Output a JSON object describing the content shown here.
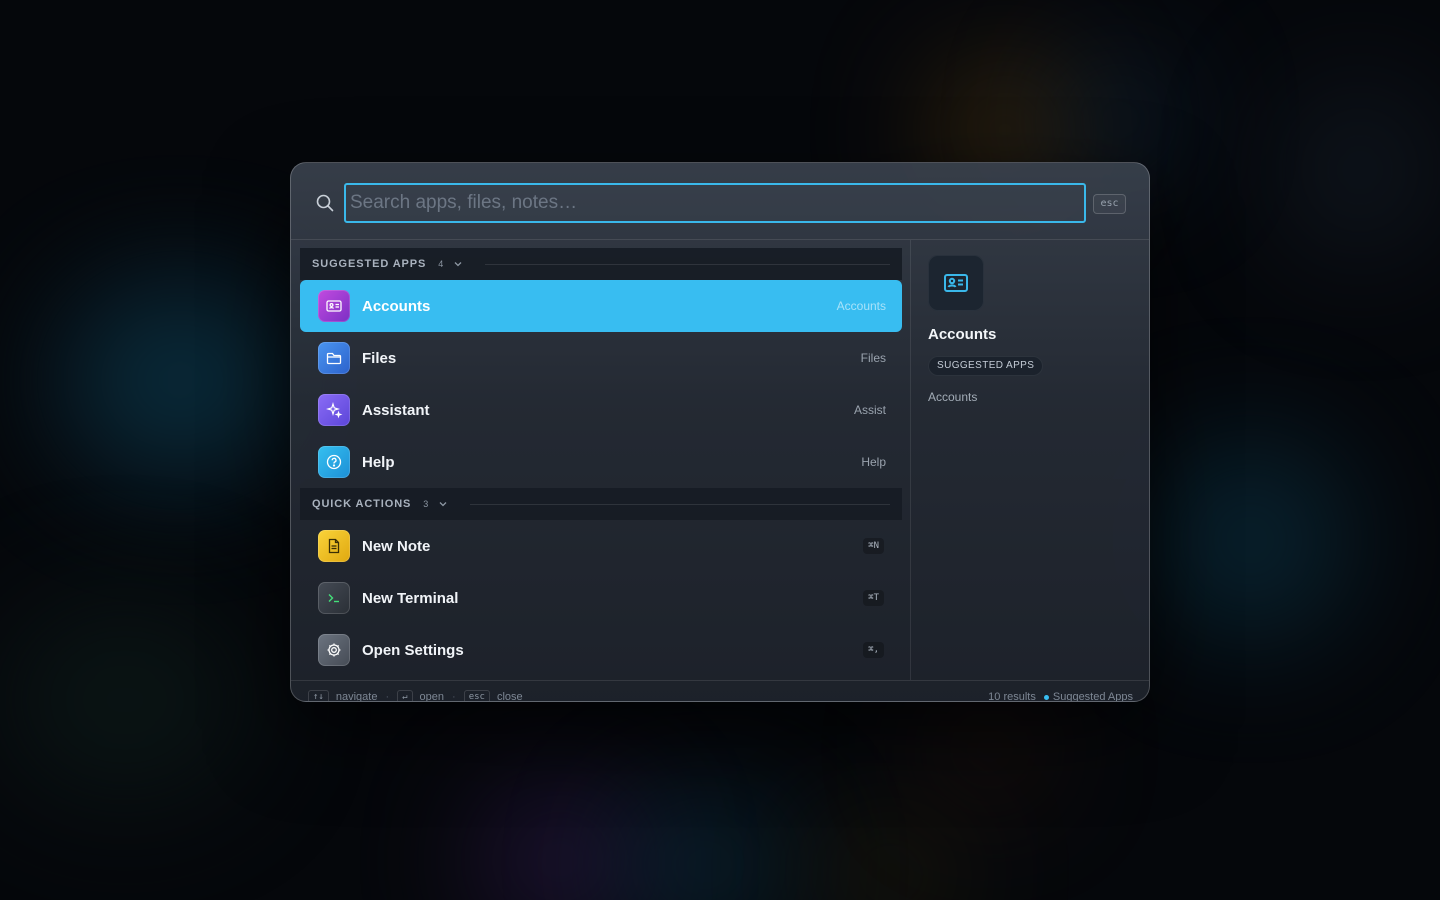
{
  "search": {
    "placeholder": "Search apps, files, notes…",
    "esc_label": "esc"
  },
  "sections": [
    {
      "title": "SUGGESTED APPS",
      "count": "4",
      "items": [
        {
          "label": "Accounts",
          "hint": "Accounts",
          "icon": "id-card-icon",
          "color": "#a73fd6",
          "active": true
        },
        {
          "label": "Files",
          "hint": "Files",
          "icon": "folder-icon",
          "color": "#3a7be0"
        },
        {
          "label": "Assistant",
          "hint": "Assist",
          "icon": "sparkles-icon",
          "color": "#7b5ef0"
        },
        {
          "label": "Help",
          "hint": "Help",
          "icon": "question-circle-icon",
          "color": "#28a9e8"
        }
      ]
    },
    {
      "title": "QUICK ACTIONS",
      "count": "3",
      "items": [
        {
          "label": "New Note",
          "shortcut": "⌘N",
          "icon": "note-icon",
          "color": "#f3c21c"
        },
        {
          "label": "New Terminal",
          "shortcut": "⌘T",
          "icon": "terminal-icon",
          "color": "#3a4048"
        },
        {
          "label": "Open Settings",
          "shortcut": "⌘,",
          "icon": "gear-icon",
          "color": "#5b6370"
        }
      ]
    }
  ],
  "detail": {
    "title": "Accounts",
    "badge": "SUGGESTED APPS",
    "subtitle": "Accounts",
    "icon": "id-card-icon"
  },
  "footer": {
    "navigate_key": "↑↓",
    "navigate_label": "navigate",
    "open_key": "↵",
    "open_label": "open",
    "close_key": "esc",
    "close_label": "close",
    "results": "10 results",
    "context": "Suggested Apps"
  },
  "colors": {
    "accent": "#38bdf1",
    "search_border": "#3ab8ea"
  }
}
